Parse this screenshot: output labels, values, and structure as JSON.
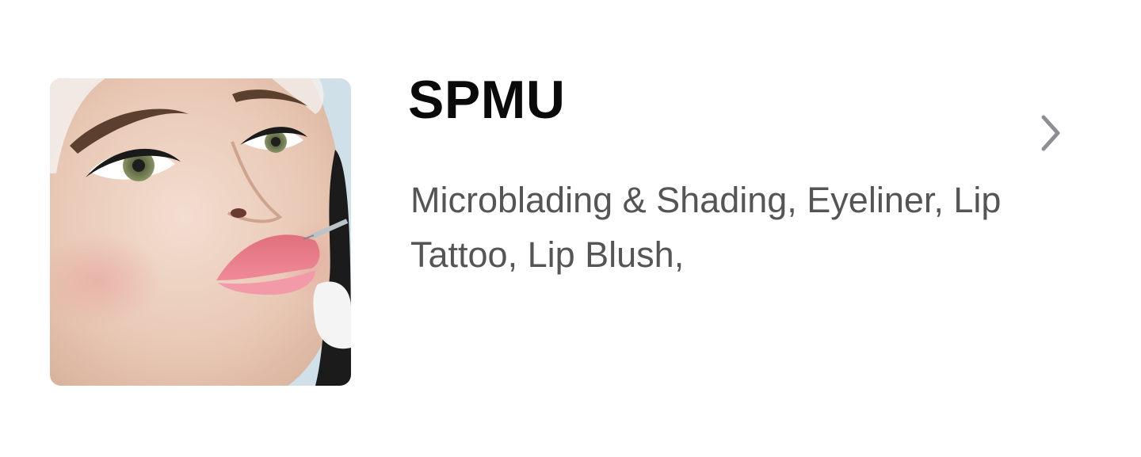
{
  "service": {
    "title": "SPMU",
    "description": "Microblading & Shading, Eyeliner, Lip Tattoo, Lip Blush,",
    "chevron_icon": "chevron-right-icon",
    "image_subject": "service-photo"
  },
  "colors": {
    "title": "#0a0a0a",
    "description": "#555555",
    "chevron": "#8e8e93",
    "background": "#ffffff"
  }
}
